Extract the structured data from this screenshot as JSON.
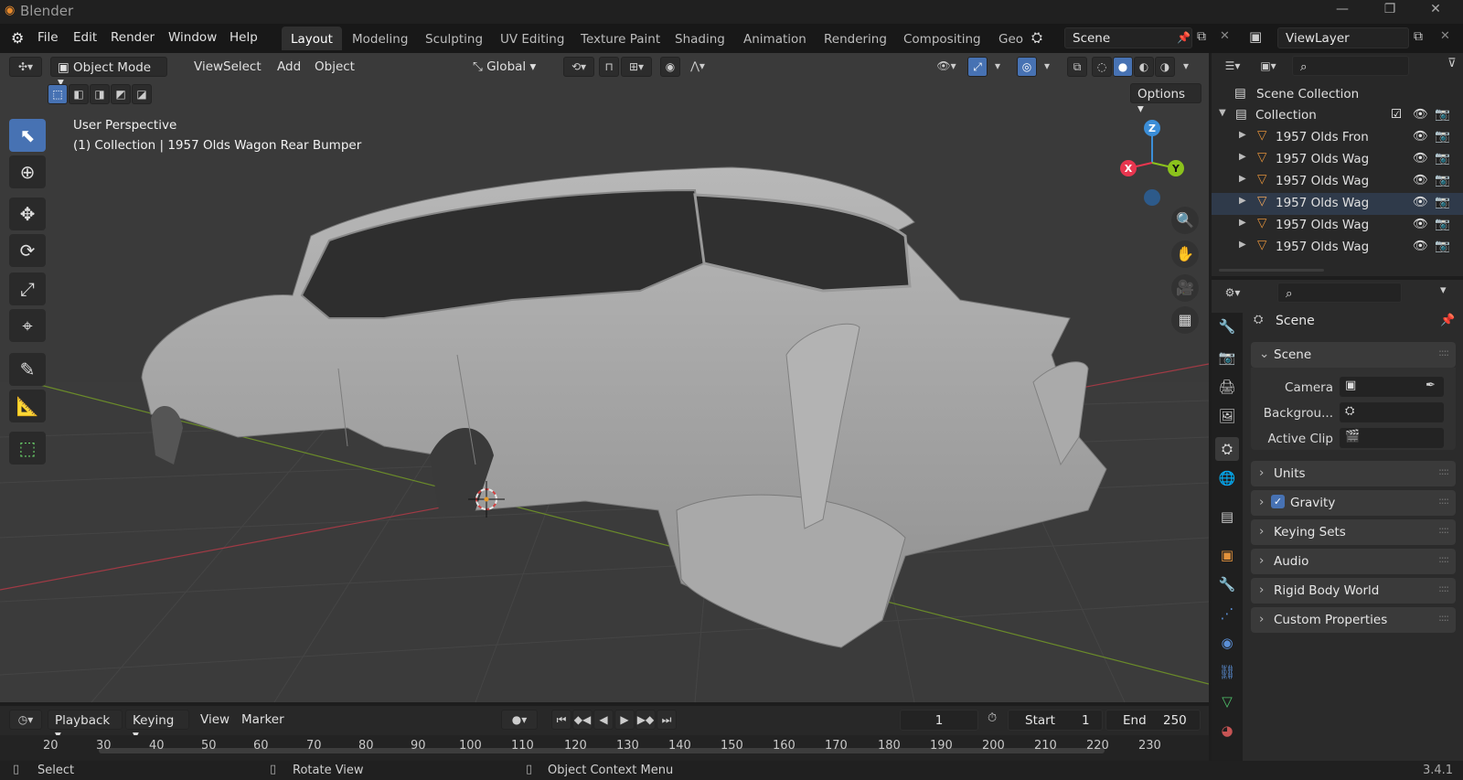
{
  "window": {
    "title": "Blender",
    "minimize": "—",
    "maximize": "❐",
    "close": "✕"
  },
  "menu": [
    "File",
    "Edit",
    "Render",
    "Window",
    "Help"
  ],
  "workspaces": [
    "Layout",
    "Modeling",
    "Sculpting",
    "UV Editing",
    "Texture Paint",
    "Shading",
    "Animation",
    "Rendering",
    "Compositing",
    "Geo"
  ],
  "scene_field": "Scene",
  "viewlayer_field": "ViewLayer",
  "viewport": {
    "mode": "Object Mode",
    "menus": [
      "View",
      "Select",
      "Add",
      "Object"
    ],
    "orientation": "Global",
    "options_label": "Options",
    "perspective": "User Perspective",
    "collection_info": "(1) Collection | 1957 Olds Wagon Rear Bumper",
    "gizmo": {
      "z": "Z",
      "x": "X",
      "y": "Y"
    }
  },
  "outliner": {
    "scene_collection": "Scene Collection",
    "collection": "Collection",
    "items": [
      "1957 Olds Fron",
      "1957 Olds Wag",
      "1957 Olds Wag",
      "1957 Olds Wag",
      "1957 Olds Wag",
      "1957 Olds Wag"
    ]
  },
  "properties": {
    "header": "Scene",
    "panel_scene": "Scene",
    "camera_label": "Camera",
    "background_label": "Backgrou...",
    "active_clip_label": "Active Clip",
    "subpanels": [
      "Units",
      "Gravity",
      "Keying Sets",
      "Audio",
      "Rigid Body World",
      "Custom Properties"
    ]
  },
  "timeline": {
    "menus": [
      "Playback",
      "Keying",
      "View",
      "Marker"
    ],
    "current_frame": "1",
    "start_label": "Start",
    "start_value": "1",
    "end_label": "End",
    "end_value": "250",
    "ticks": [
      "20",
      "30",
      "40",
      "50",
      "60",
      "70",
      "80",
      "90",
      "100",
      "110",
      "120",
      "130",
      "140",
      "150",
      "160",
      "170",
      "180",
      "190",
      "200",
      "210",
      "220",
      "230"
    ]
  },
  "status": {
    "select": "Select",
    "rotate": "Rotate View",
    "context": "Object Context Menu",
    "version": "3.4.1"
  },
  "colors": {
    "accent": "#4772b3",
    "x_axis": "#e8364f",
    "y_axis": "#8bc21c",
    "z_axis": "#3b8ed8",
    "object_orange": "#e2913b"
  }
}
